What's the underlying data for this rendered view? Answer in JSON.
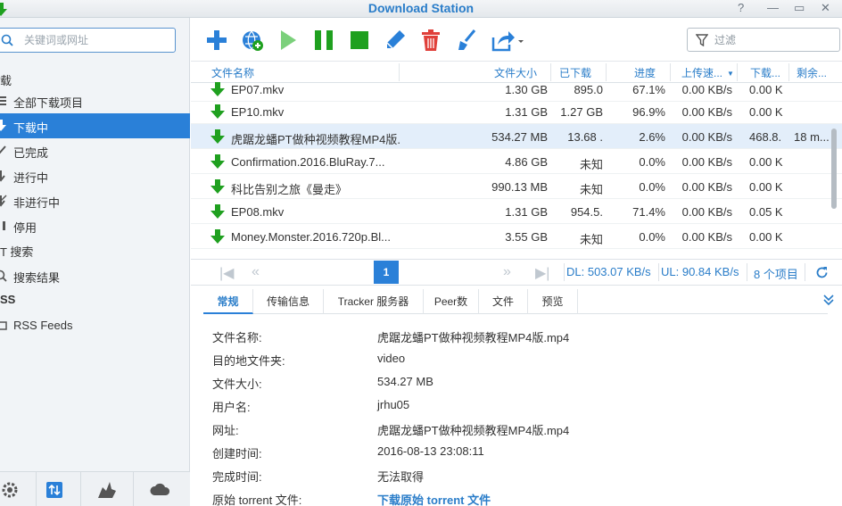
{
  "window": {
    "title": "Download Station",
    "controls": [
      "?",
      "—",
      "▭",
      "✕"
    ]
  },
  "sidebar": {
    "search_placeholder": "关键词或网址",
    "sections": {
      "download": "载",
      "search": "T 搜索",
      "rss": "SS"
    },
    "items": [
      {
        "label": "全部下载项目",
        "icon": "list-icon"
      },
      {
        "label": "下载中",
        "icon": "download-icon"
      },
      {
        "label": "已完成",
        "icon": "check-icon"
      },
      {
        "label": "进行中",
        "icon": "active-icon"
      },
      {
        "label": "非进行中",
        "icon": "inactive-icon"
      },
      {
        "label": "停用",
        "icon": "pause-icon"
      },
      {
        "label": "搜索结果",
        "icon": "search-result-icon"
      },
      {
        "label": "RSS Feeds",
        "icon": "rss-icon"
      }
    ],
    "bottom_buttons": [
      "settings-icon",
      "transfer-icon",
      "emule-icon",
      "cloud-icon"
    ]
  },
  "toolbar": {
    "tools": [
      "add-icon",
      "add-url-icon",
      "resume-icon",
      "pause-icon",
      "stop-icon",
      "edit-icon",
      "delete-icon",
      "clear-icon",
      "share-icon"
    ],
    "filter_placeholder": "过滤"
  },
  "grid": {
    "columns": [
      "文件名称",
      "文件大小",
      "已下载",
      "进度",
      "上传速...",
      "下载...",
      "剩余..."
    ],
    "rows": [
      {
        "name": "EP07.mkv",
        "size": "1.30 GB",
        "downloaded": "895.0",
        "progress": "67.1%",
        "up": "0.00 KB/s",
        "down": "0.00 K",
        "remain": ""
      },
      {
        "name": "EP10.mkv",
        "size": "1.31 GB",
        "downloaded": "1.27 GB",
        "progress": "96.9%",
        "up": "0.00 KB/s",
        "down": "0.00 K",
        "remain": ""
      },
      {
        "name": "虎踞龙蟠PT做种视频教程MP4版...",
        "size": "534.27 MB",
        "downloaded": "13.68 .",
        "progress": "2.6%",
        "up": "0.00 KB/s",
        "down": "468.8.",
        "remain": "18 m..."
      },
      {
        "name": "Confirmation.2016.BluRay.7...",
        "size": "4.86 GB",
        "downloaded": "未知",
        "progress": "0.0%",
        "up": "0.00 KB/s",
        "down": "0.00 K",
        "remain": ""
      },
      {
        "name": "科比告别之旅《曼走》",
        "size": "990.13 MB",
        "downloaded": "未知",
        "progress": "0.0%",
        "up": "0.00 KB/s",
        "down": "0.00 K",
        "remain": ""
      },
      {
        "name": "EP08.mkv",
        "size": "1.31 GB",
        "downloaded": "954.5.",
        "progress": "71.4%",
        "up": "0.00 KB/s",
        "down": "0.05 K",
        "remain": ""
      },
      {
        "name": "Money.Monster.2016.720p.Bl...",
        "size": "3.55 GB",
        "downloaded": "未知",
        "progress": "0.0%",
        "up": "0.00 KB/s",
        "down": "0.00 K",
        "remain": ""
      }
    ]
  },
  "status": {
    "page": "1",
    "dl": "DL: 503.07 KB/s",
    "ul": "UL: 90.84 KB/s",
    "count": "8 个项目"
  },
  "details": {
    "tabs": [
      "常规",
      "传输信息",
      "Tracker 服务器",
      "Peer数",
      "文件",
      "预览"
    ],
    "fields": [
      {
        "key": "文件名称:",
        "value": "虎踞龙蟠PT做种视频教程MP4版.mp4"
      },
      {
        "key": "目的地文件夹:",
        "value": "video"
      },
      {
        "key": "文件大小:",
        "value": "534.27 MB"
      },
      {
        "key": "用户名:",
        "value": "jrhu05"
      },
      {
        "key": "网址:",
        "value": "虎踞龙蟠PT做种视频教程MP4版.mp4"
      },
      {
        "key": "创建时间:",
        "value": "2016-08-13 23:08:11"
      },
      {
        "key": "完成时间:",
        "value": "无法取得"
      },
      {
        "key": "原始 torrent 文件:",
        "value": "下载原始 torrent 文件"
      }
    ]
  },
  "colors": {
    "accent": "#2a80d8",
    "link": "#2a7dc9",
    "download_green": "#1fa01f",
    "selected_row": "#e3eefa"
  }
}
